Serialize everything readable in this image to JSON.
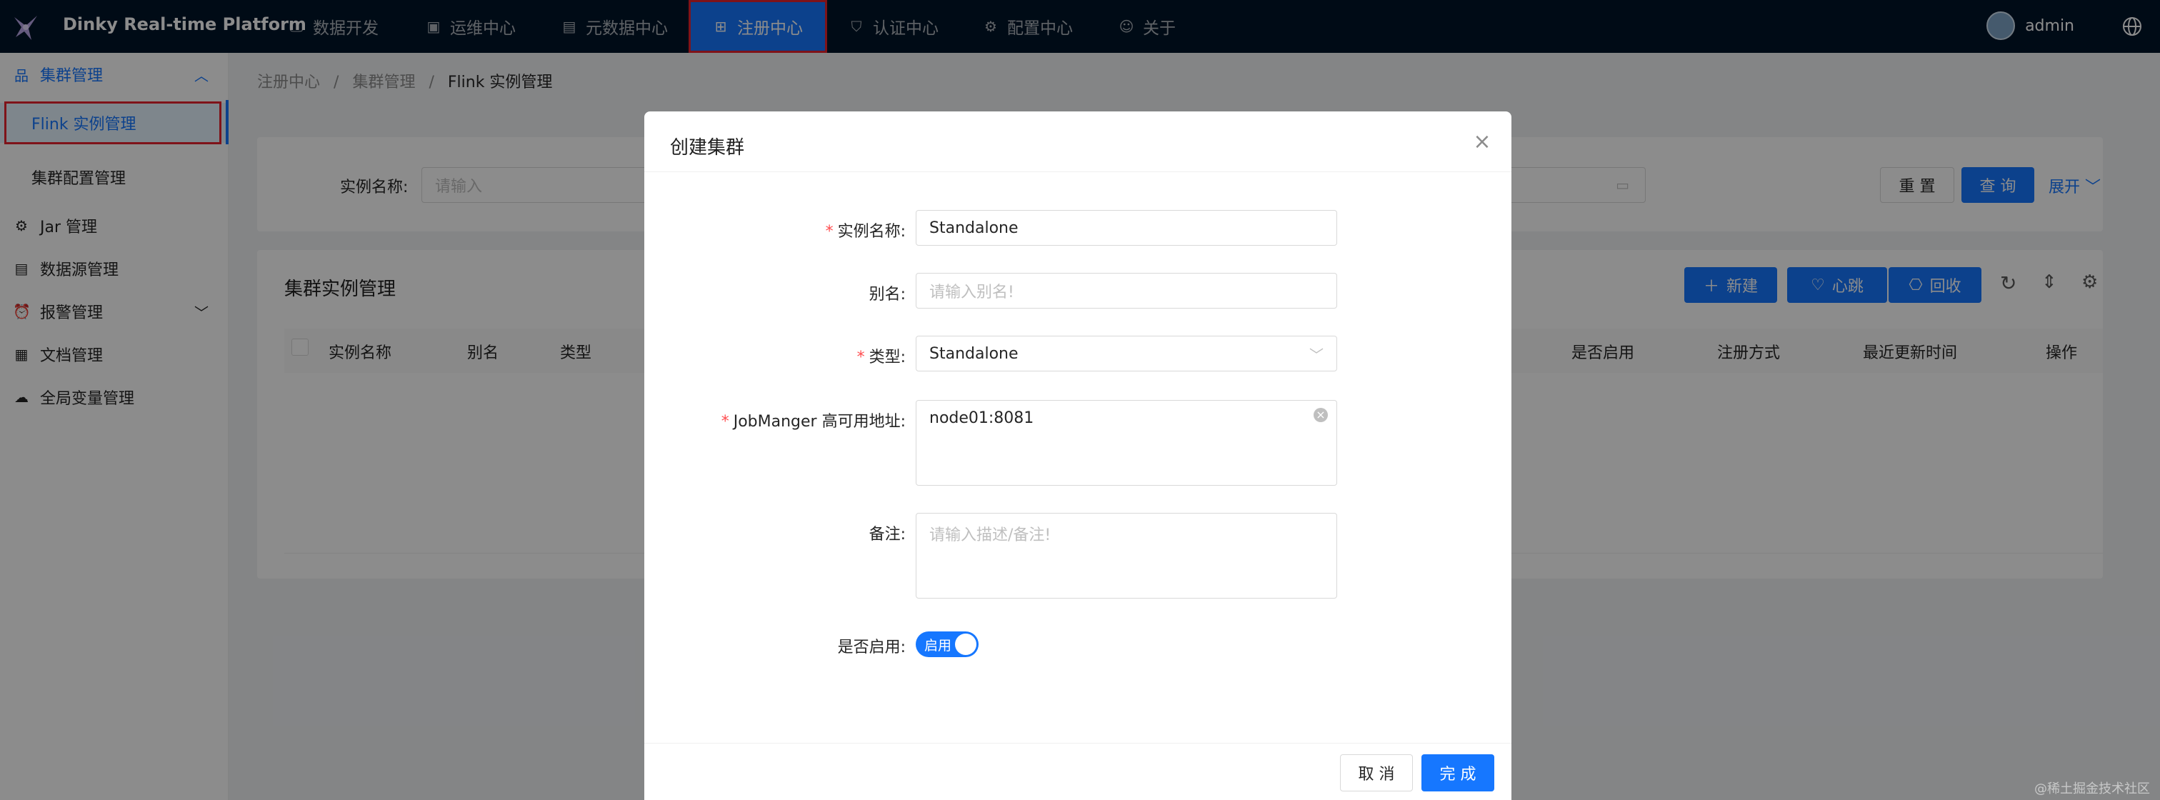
{
  "topbar": {
    "brand": "Dinky Real-time Platform",
    "nav": [
      {
        "label": "数据开发",
        "icon": "monitor-icon"
      },
      {
        "label": "运维中心",
        "icon": "dashboard-icon"
      },
      {
        "label": "元数据中心",
        "icon": "database-icon"
      },
      {
        "label": "注册中心",
        "icon": "appstore-icon"
      },
      {
        "label": "认证中心",
        "icon": "shield-icon"
      },
      {
        "label": "配置中心",
        "icon": "gear-icon"
      },
      {
        "label": "关于",
        "icon": "smile-icon"
      }
    ],
    "active_nav": "注册中心",
    "user": "admin"
  },
  "sidebar": {
    "items": [
      {
        "label": "集群管理",
        "icon": "cluster-icon"
      },
      {
        "label": "Flink 实例管理"
      },
      {
        "label": "集群配置管理"
      },
      {
        "label": "Jar 管理",
        "icon": "jar-icon"
      },
      {
        "label": "数据源管理",
        "icon": "datasource-icon"
      },
      {
        "label": "报警管理",
        "icon": "alert-icon"
      },
      {
        "label": "文档管理",
        "icon": "document-icon"
      },
      {
        "label": "全局变量管理",
        "icon": "cloud-icon"
      }
    ]
  },
  "breadcrumb": {
    "items": [
      "注册中心",
      "集群管理",
      "Flink 实例管理"
    ]
  },
  "search": {
    "label": "实例名称:",
    "placeholder": "请输入",
    "reset": "重 置",
    "query": "查 询",
    "expand": "展开"
  },
  "table": {
    "title": "集群实例管理",
    "buttons": {
      "new": "新建",
      "heartbeat": "心跳",
      "recycle": "回收"
    },
    "columns_left": [
      "实例名称",
      "别名",
      "类型"
    ],
    "columns_right": [
      "是否启用",
      "注册方式",
      "最近更新时间",
      "操作"
    ]
  },
  "modal": {
    "title": "创建集群",
    "fields": {
      "name": {
        "label": "实例名称",
        "value": "Standalone"
      },
      "alias": {
        "label": "别名",
        "placeholder": "请输入别名!"
      },
      "type": {
        "label": "类型",
        "value": "Standalone"
      },
      "address": {
        "label": "JobManger 高可用地址",
        "value": "node01:8081"
      },
      "note": {
        "label": "备注",
        "placeholder": "请输入描述/备注!"
      },
      "enabled": {
        "label": "是否启用",
        "value": "启用"
      }
    },
    "colon": ":",
    "cancel": "取 消",
    "submit": "完 成"
  },
  "watermark": "@稀土掘金技术社区",
  "colors": {
    "primary": "#1677ff",
    "header": "#001529",
    "highlight": "#e8242e"
  }
}
